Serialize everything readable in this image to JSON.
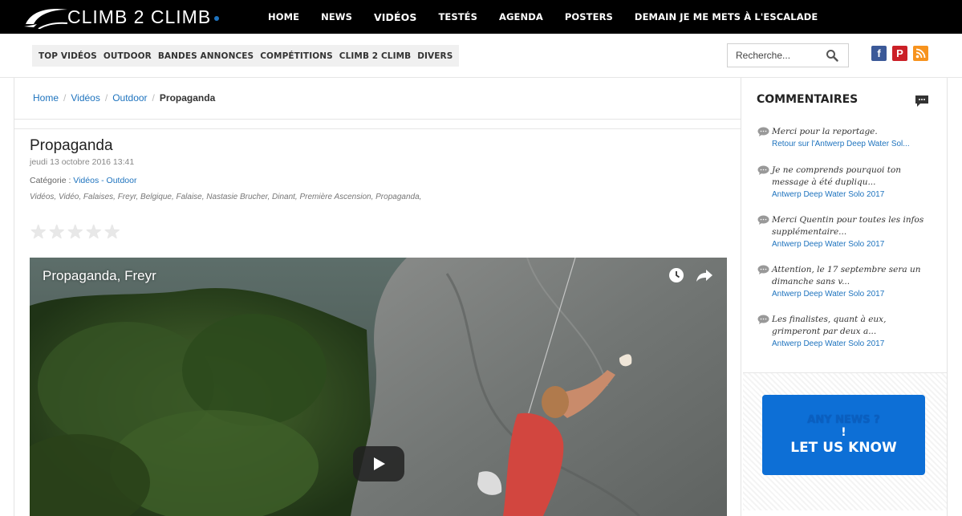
{
  "brand": {
    "name": "CLIMB 2 CLIMB",
    "accent": "#1e73be"
  },
  "main_nav": [
    {
      "label": "HOME",
      "active": false
    },
    {
      "label": "NEWS",
      "active": false
    },
    {
      "label": "VIDÉOS",
      "active": true
    },
    {
      "label": "TESTÉS",
      "active": false
    },
    {
      "label": "AGENDA",
      "active": false
    },
    {
      "label": "POSTERS",
      "active": false
    },
    {
      "label": "DEMAIN JE ME METS À L'ESCALADE",
      "active": false
    }
  ],
  "sub_nav": [
    "TOP VIDÉOS",
    "OUTDOOR",
    "BANDES ANNONCES",
    "COMPÉTITIONS",
    "CLIMB 2 CLIMB",
    "DIVERS"
  ],
  "search": {
    "placeholder": "Recherche..."
  },
  "social": {
    "facebook": "f",
    "pinterest": "P",
    "rss_icon": "rss-icon"
  },
  "breadcrumb": {
    "home": "Home",
    "videos": "Vidéos",
    "outdoor": "Outdoor",
    "current": "Propaganda"
  },
  "article": {
    "title": "Propaganda",
    "date": "jeudi 13 octobre 2016 13:41",
    "category_label": "Catégorie : ",
    "category_link": "Vidéos - Outdoor",
    "tags": "Vidéos, Vidéo, Falaises, Freyr, Belgique, Falaise, Nastasie Brucher, Dinant, Première Ascension, Propaganda,",
    "rating": 0
  },
  "video": {
    "title": "Propaganda, Freyr"
  },
  "sidebar": {
    "title": "COMMENTAIRES",
    "comments": [
      {
        "text": "Merci pour la reportage.",
        "link": "Retour sur l'Antwerp Deep Water Sol..."
      },
      {
        "text": "Je ne comprends pourquoi ton message à été dupliqu...",
        "link": "Antwerp Deep Water Solo 2017"
      },
      {
        "text": "Merci Quentin pour toutes les infos supplémentaire...",
        "link": "Antwerp Deep Water Solo 2017"
      },
      {
        "text": "Attention, le 17 septembre sera un dimanche sans v...",
        "link": "Antwerp Deep Water Solo 2017"
      },
      {
        "text": "Les finalistes, quant à eux, grimperont par deux a...",
        "link": "Antwerp Deep Water Solo 2017"
      }
    ],
    "banner": {
      "line1": "ANY NEWS ?",
      "line2": "!",
      "line3": "LET US KNOW"
    }
  }
}
